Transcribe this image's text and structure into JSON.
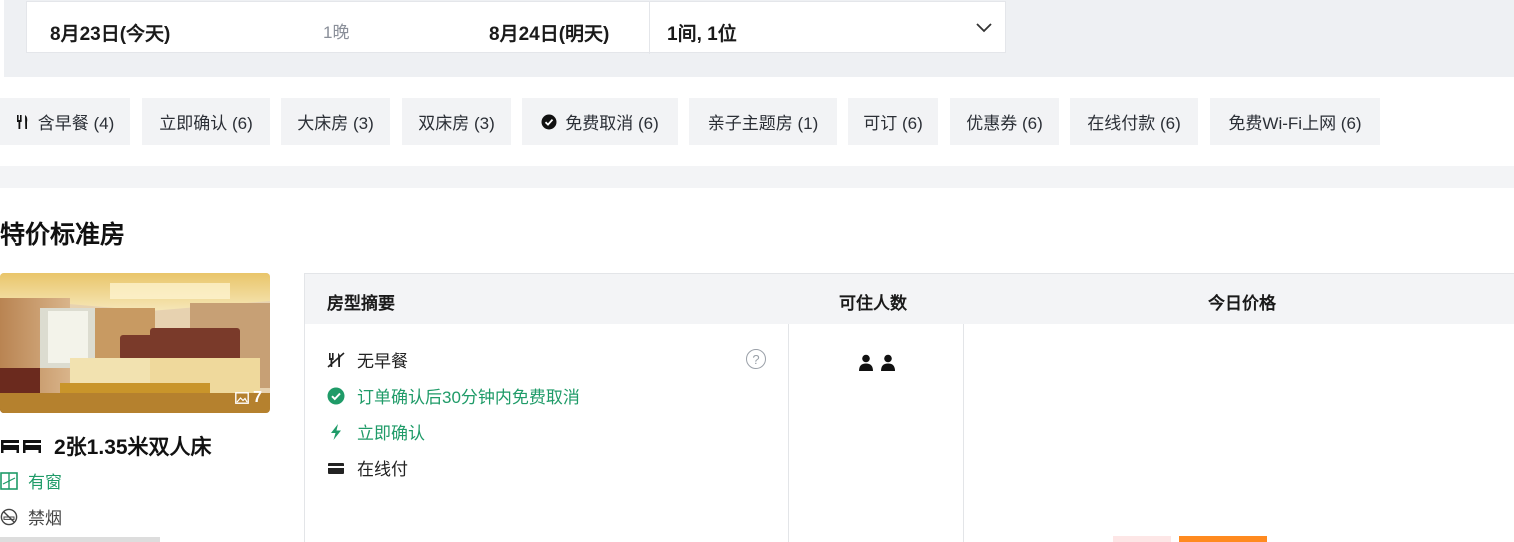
{
  "search": {
    "checkin": "8月23日(今天)",
    "nights": "1晚",
    "checkout": "8月24日(明天)",
    "rooms_guests": "1间, 1位"
  },
  "filters": [
    {
      "label": "含早餐 (4)",
      "icon": "fork-knife-icon"
    },
    {
      "label": "立即确认 (6)"
    },
    {
      "label": "大床房 (3)"
    },
    {
      "label": "双床房 (3)"
    },
    {
      "label": "免费取消 (6)",
      "icon": "check-circle-icon"
    },
    {
      "label": "亲子主题房 (1)"
    },
    {
      "label": "可订 (6)"
    },
    {
      "label": "优惠券 (6)"
    },
    {
      "label": "在线付款 (6)"
    },
    {
      "label": "免费Wi-Fi上网 (6)"
    }
  ],
  "room": {
    "title": "特价标准房",
    "photo_count": "7",
    "bed": "2张1.35米双人床",
    "window": "有窗",
    "smoking": "禁烟"
  },
  "table": {
    "headers": [
      "房型摘要",
      "可住人数",
      "今日价格"
    ],
    "features": [
      {
        "text": "无早餐",
        "icon": "no-breakfast-icon"
      },
      {
        "text": "订单确认后30分钟内免费取消",
        "icon": "check-circle-icon"
      },
      {
        "text": "立即确认",
        "icon": "lightning-icon"
      },
      {
        "text": "在线付",
        "icon": "card-icon"
      }
    ]
  },
  "colors": {
    "green": "#1f9b68",
    "chip_bg": "#f2f3f5",
    "header_bg": "#f3f4f6",
    "orange": "#ff8a1f"
  }
}
